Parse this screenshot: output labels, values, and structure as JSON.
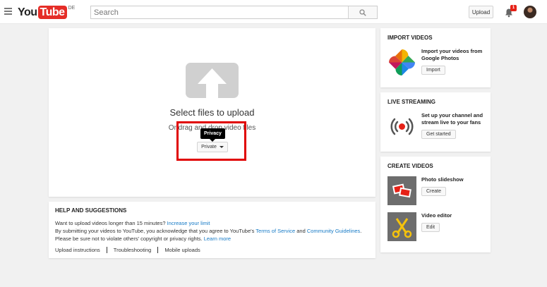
{
  "header": {
    "logo_you": "You",
    "logo_tube": "Tube",
    "logo_region": "DE",
    "search_placeholder": "Search",
    "upload_label": "Upload",
    "notification_count": "1"
  },
  "upload": {
    "title": "Select files to upload",
    "subtitle": "Or drag and drop video files",
    "tooltip": "Privacy",
    "privacy_value": "Private"
  },
  "help": {
    "title": "HELP AND SUGGESTIONS",
    "line1_text": "Want to upload videos longer than 15 minutes?",
    "line1_link": "Increase your limit",
    "line2_text": "By submitting your videos to YouTube, you acknowledge that you agree to YouTube's",
    "line2_link1": "Terms of Service",
    "line2_and": "and",
    "line2_link2": "Community Guidelines",
    "line3_text": "Please be sure not to violate others' copyright or privacy rights.",
    "line3_link": "Learn more",
    "links": [
      "Upload instructions",
      "Troubleshooting",
      "Mobile uploads"
    ]
  },
  "import": {
    "title": "IMPORT VIDEOS",
    "text": "Import your videos from Google Photos",
    "button": "Import"
  },
  "live": {
    "title": "LIVE STREAMING",
    "text": "Set up your channel and stream live to your fans",
    "button": "Get started"
  },
  "create": {
    "title": "CREATE VIDEOS",
    "items": [
      {
        "label": "Photo slideshow",
        "button": "Create"
      },
      {
        "label": "Video editor",
        "button": "Edit"
      }
    ]
  },
  "icons": {
    "menu": "hamburger-menu-icon",
    "search": "search-icon",
    "bell": "bell-icon",
    "upload": "upload-arrow-icon",
    "photos": "google-photos-icon",
    "live": "live-broadcast-icon"
  },
  "colors": {
    "brand_red": "#e52d27",
    "link_blue": "#167ac6",
    "highlight": "#e00000"
  }
}
